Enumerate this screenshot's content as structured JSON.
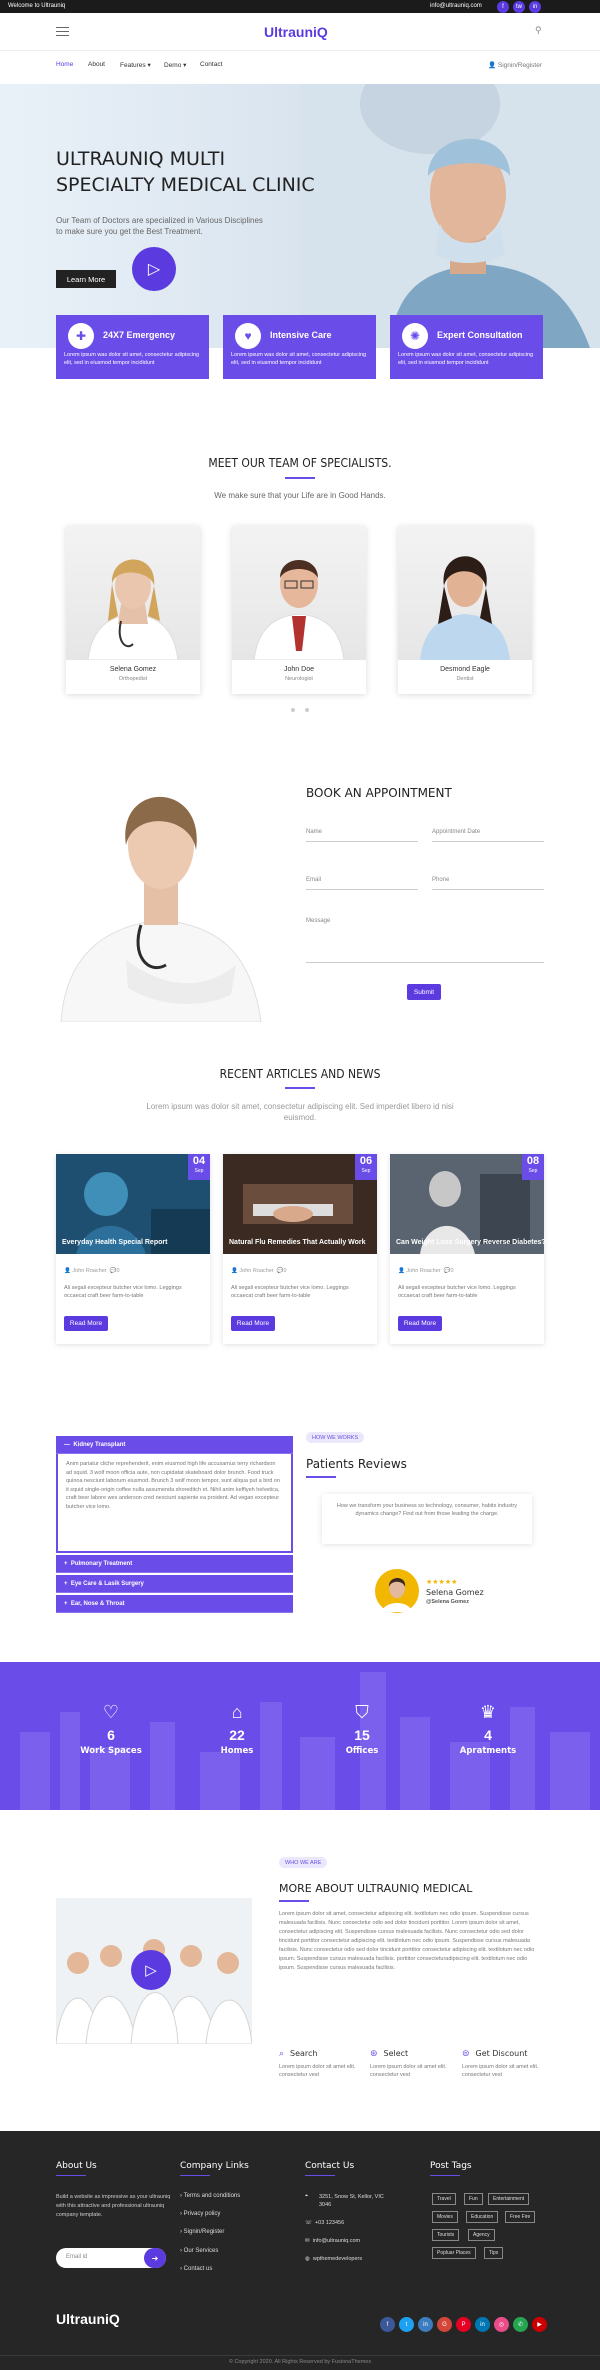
{
  "topbar": {
    "welcome": "Welcome to Ultrauniq",
    "email": "info@ultrauniq.com",
    "social": [
      "f",
      "tw",
      "in"
    ]
  },
  "brand": {
    "logo": "UltrauniQ"
  },
  "nav": {
    "items": [
      "Home",
      "About",
      "Features",
      "Demo",
      "Contact"
    ],
    "signin": "Signin/Register"
  },
  "hero": {
    "title_l1": "ULTRAUNIQ MULTI",
    "title_l2": "SPECIALTY MEDICAL CLINIC",
    "sub_l1": "Our Team of Doctors are specialized in Various Disciplines",
    "sub_l2": "to make sure you get the Best Treatment.",
    "cta": "Learn More"
  },
  "services": [
    {
      "title": "24X7 Emergency",
      "desc": "Lorem ipsum was dolor sit amet, consectetur adipiscing elit, sed in eiusmod tempor incididunt"
    },
    {
      "title": "Intensive Care",
      "desc": "Lorem ipsum was dolor sit amet, consectetur adipiscing elit, sed in eiusmod tempor incididunt"
    },
    {
      "title": "Expert Consultation",
      "desc": "Lorem ipsum was dolor sit amet, consectetur adipiscing elit, sed in eiusmod tempor incididunt"
    }
  ],
  "team": {
    "title": "MEET OUR TEAM OF SPECIALISTS.",
    "sub": "We make sure that your Life are in Good Hands.",
    "members": [
      {
        "name": "Selena Gomez",
        "role": "Orthopedist"
      },
      {
        "name": "John Doe",
        "role": "Neurologist"
      },
      {
        "name": "Desmond Eagle",
        "role": "Dentist"
      }
    ]
  },
  "appointment": {
    "title": "BOOK AN APPOINTMENT",
    "name": "Name",
    "date": "Appointment Date",
    "email": "Email",
    "phone": "Phone",
    "message": "Message",
    "submit": "Submit"
  },
  "articles": {
    "title": "RECENT ARTICLES AND NEWS",
    "sub_l1": "Lorem ipsum was dolor sit amet, consectetur adipiscing elit. Sed imperdiet libero id nisi",
    "sub_l2": "euismod.",
    "items": [
      {
        "day": "04",
        "mon": "Sep",
        "title": "Everyday Health Special Report",
        "author": "John Roacher",
        "comments": "0",
        "excerpt": "Ali segali excepteur butcher vice lomo. Leggings occaecat craft beer farm-to-table",
        "more": "Read More"
      },
      {
        "day": "06",
        "mon": "Sep",
        "title": "Natural Flu Remedies That Actually Work",
        "author": "John Roacher",
        "comments": "0",
        "excerpt": "Ali segali excepteur butcher vice lomo. Leggings occaecat craft beer farm-to-table",
        "more": "Read More"
      },
      {
        "day": "08",
        "mon": "Sep",
        "title": "Can Weight Loss Surgery Reverse Diabetes?",
        "author": "John Roacher",
        "comments": "0",
        "excerpt": "Ali segali excepteur butcher vice lomo. Leggings occaecat craft beer farm-to-table",
        "more": "Read More"
      }
    ]
  },
  "accordion": {
    "items": [
      "Kidney Transplant",
      "Pulmonary Treatment",
      "Eye Care & Lasik Surgery",
      "Ear, Nose & Throat"
    ],
    "body": "Anim pariatur cliche reprehenderit, enim eiusmod high life accusamus terry richardson ad squid. 3 wolf moon officia aute, non cupidatat skateboard dolor brunch. Food truck quinoa nesciunt laborum eiusmod. Brunch 3 wolf moon tempor, sunt aliqua put a bird on it squid single-origin coffee nulla assumenda shoreditch et. Nihil anim keffiyeh helvetica, craft beer labore wes anderson cred nesciunt sapiente ea proident. Ad vegan excepteur butcher vice lomo."
  },
  "reviews": {
    "badge": "HOW WE WORKS",
    "title": "Patients Reviews",
    "quote": "How we transform your business so technology, consumer, habits industry dynamics change? Find out from those leading the charge.",
    "stars": "★★★★★",
    "name": "Selena Gomez",
    "handle": "@Selena Gomez"
  },
  "stats": [
    {
      "icon": "heart-icon",
      "n": "6",
      "l": "Work Spaces"
    },
    {
      "icon": "bank-icon",
      "n": "22",
      "l": "Homes"
    },
    {
      "icon": "shield-icon",
      "n": "15",
      "l": "Offices"
    },
    {
      "icon": "crown-icon",
      "n": "4",
      "l": "Apratments"
    }
  ],
  "about": {
    "badge": "WHO WE ARE",
    "title": "MORE ABOUT ULTRAUNIQ MEDICAL",
    "body": "Lorem ipsum dolor sit amet, consectetur adipiscing elit. textilotum nec odio ipsum. Suspendisse cursus malesuada facilisis. Nunc consectetur odio sed dolor tincidunt porttitor. Lorem ipsum dolor sit amet, consectetur adipiscing elit. Suspendisse cursus malesuada facilisis. Nunc consectetur odio sed dolor tincidunt porttitor consectetur adipiscing elit. textilotum nec odio ipsum. Suspendisse cursus malesuada facilisis. Nunc consectetur odio sed dolor tincidunt porttitor consectetur adipiscing elit. textilotum nec odio ipsum. Suspendisse cursus malesuada facilisis. porttitor consecteturadipiscing elit. textilotum nec odio ipsum. Suspendisse cursus malesuada facilisis.",
    "features": [
      {
        "title": "Search",
        "desc": "Lorem ipsum dolor sit amet elit. consectetur vest"
      },
      {
        "title": "Select",
        "desc": "Lorem ipsum dolor sit amet elit. consectetur vest"
      },
      {
        "title": "Get Discount",
        "desc": "Lorem ipsum dolor sit amet elit. consectetur vest"
      }
    ]
  },
  "footer": {
    "about_title": "About Us",
    "about_text": "Build a website as impressive as your ultrauniq with this attractive and professional ultrauniq company template.",
    "email_placeholder": "Email id",
    "links_title": "Company Links",
    "links": [
      "Terms and conditions",
      "Privacy policy",
      "Signin/Register",
      "Our Services",
      "Contact us"
    ],
    "contact_title": "Contact Us",
    "address_l1": "3251, Snow St, Kellor, VIC",
    "address_l2": "3046",
    "phone": "+03 123456",
    "email": "info@ultrauniq.com",
    "web": "wpthemedevelopers",
    "tags_title": "Post Tags",
    "tags": [
      "Travel",
      "Fun",
      "Entertainment",
      "Movies",
      "Education",
      "Free Fire",
      "Tourists",
      "Agency",
      "Popluar Places",
      "Tips"
    ],
    "logo": "UltrauniQ",
    "copyright": "© Copyright 2020. All Rights Reserved by FusionaThemes"
  }
}
